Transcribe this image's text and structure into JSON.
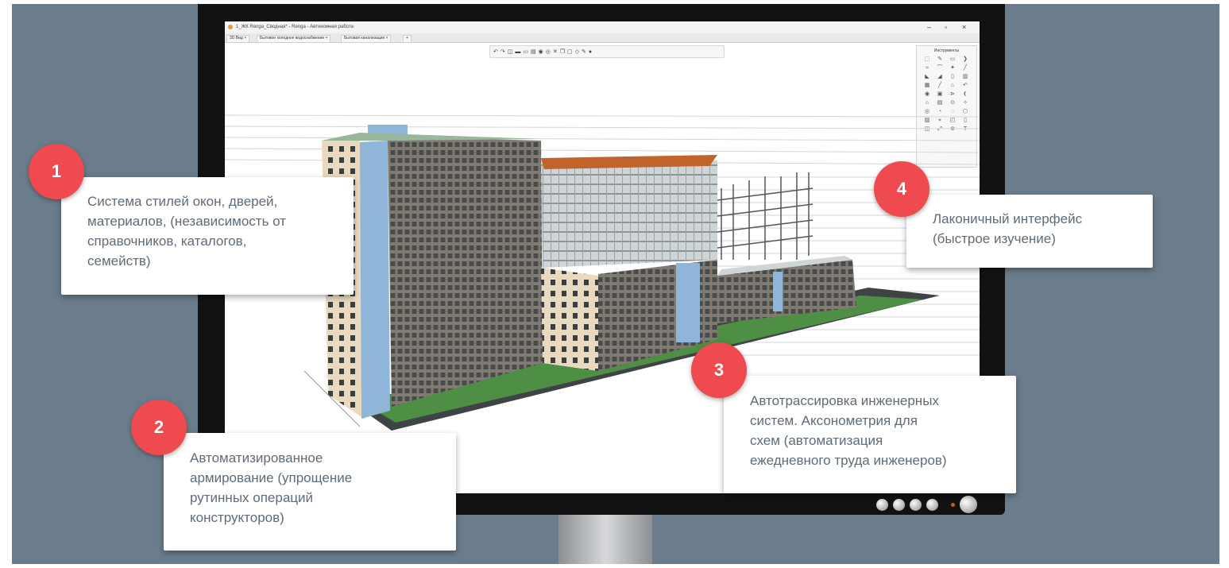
{
  "app": {
    "window_title": "1_ЖК Renga_Сводная* - Renga - Автономная работа",
    "tabs": [
      "3D Вид",
      "Бытовое холодное водоснабжение",
      "Бытовая канализация"
    ],
    "tools_panel_title": "Инструменты",
    "window_controls": [
      "minimize-icon",
      "restore-icon",
      "close-icon"
    ]
  },
  "callouts": [
    {
      "number": "1",
      "text": "Система стилей окон, дверей,\nматериалов, (независимость от\nсправочников, каталогов,\nсемейств)"
    },
    {
      "number": "2",
      "text": "Автоматизированное\nармирование (упрощение\nрутинных операций\nконструкторов)"
    },
    {
      "number": "3",
      "text": "Автотрассировка инженерных\nсистем. Аксонометрия для\nсхем (автоматизация\nежедневного труда инженеров)"
    },
    {
      "number": "4",
      "text": "Лаконичный интерфейс\n(быстрое изучение)"
    }
  ],
  "colors": {
    "background": "#6b7d8c",
    "badge": "#ee4a4f",
    "callout_text": "#5f6b76",
    "facade": "#e9d9bf",
    "accent_blue": "#8fb5d8",
    "roof_orange": "#c0642c",
    "lawn": "#4f8f45"
  }
}
